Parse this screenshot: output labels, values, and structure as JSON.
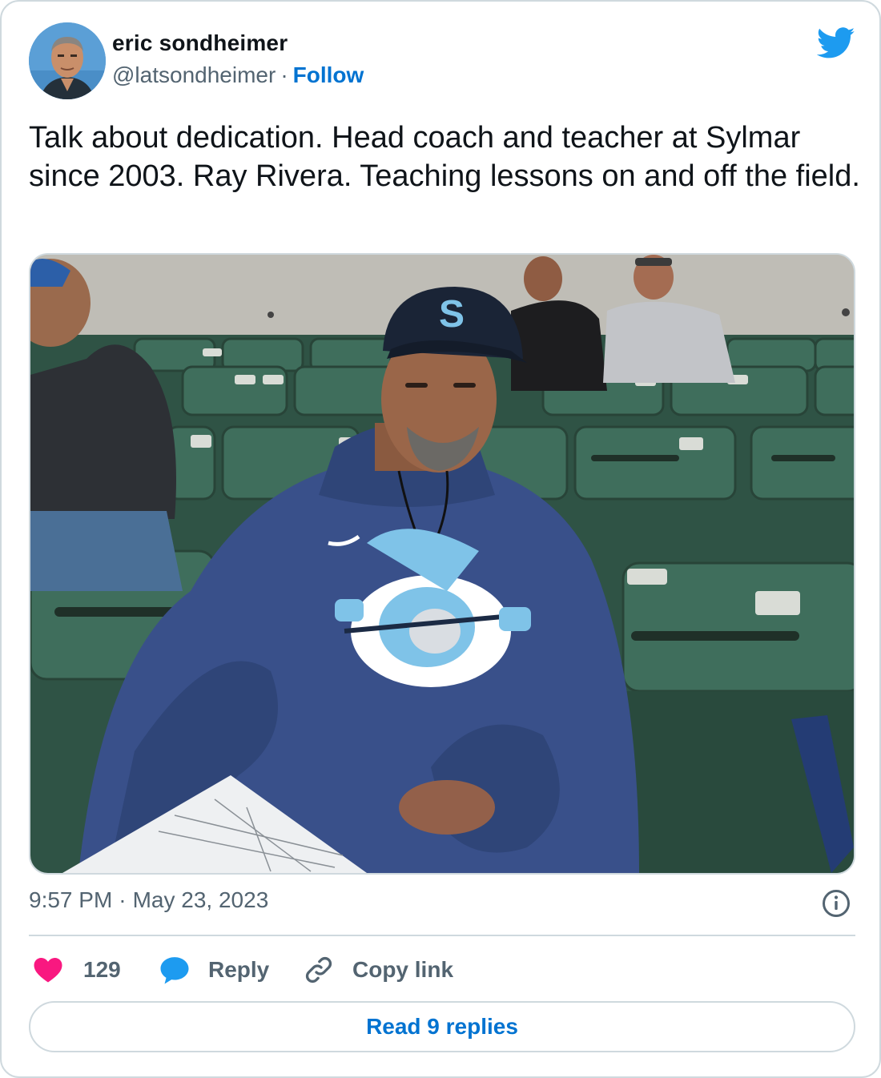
{
  "author": {
    "name": "eric sondheimer",
    "handle": "@latsondheimer",
    "separator": "·",
    "follow_label": "Follow"
  },
  "tweet": {
    "text": "Talk about dedication. Head coach and teacher at Sylmar since 2003. Ray Rivera. Teaching lessons on and off the field.",
    "time": "9:57 PM",
    "separator": "·",
    "date": "May 23, 2023"
  },
  "actions": {
    "like_count": "129",
    "reply_label": "Reply",
    "copy_link_label": "Copy link",
    "read_replies_label": "Read 9 replies"
  },
  "icons": {
    "brand": "twitter-bird-icon",
    "info": "info-icon",
    "like": "heart-icon",
    "reply": "speech-bubble-icon",
    "copy": "link-icon"
  },
  "colors": {
    "brand": "#1d9bf0",
    "link": "#0073d1",
    "like": "#f91880",
    "muted": "#536471",
    "border": "#cfd9de"
  },
  "media": {
    "cap_letter": "S"
  }
}
